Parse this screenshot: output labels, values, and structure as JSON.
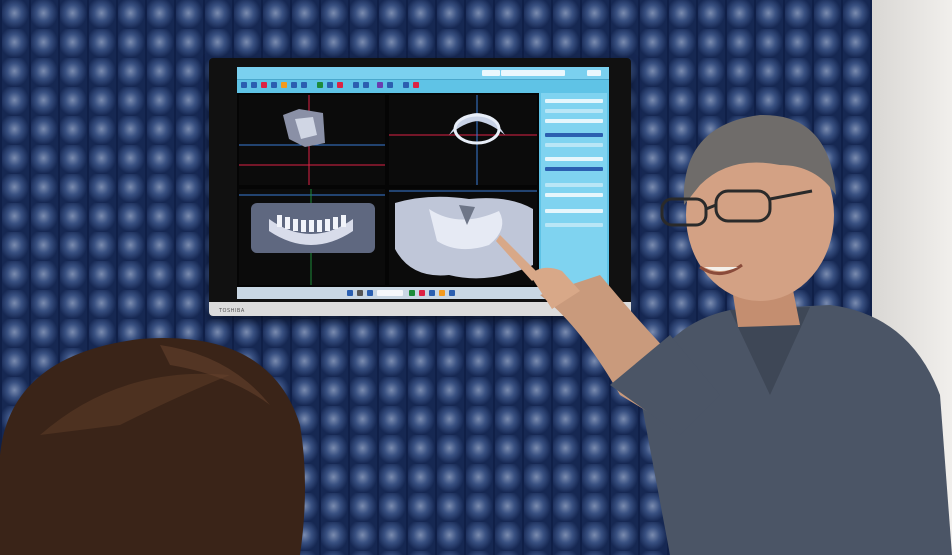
{
  "scene": {
    "wall_color": "#3c5f9a",
    "scrub_color": "#4b5566",
    "screen_color": "#5fc3e6"
  },
  "monitor": {
    "brand_text": "TOSHIBA",
    "screen_tabs": [
      "",
      "",
      ""
    ]
  }
}
